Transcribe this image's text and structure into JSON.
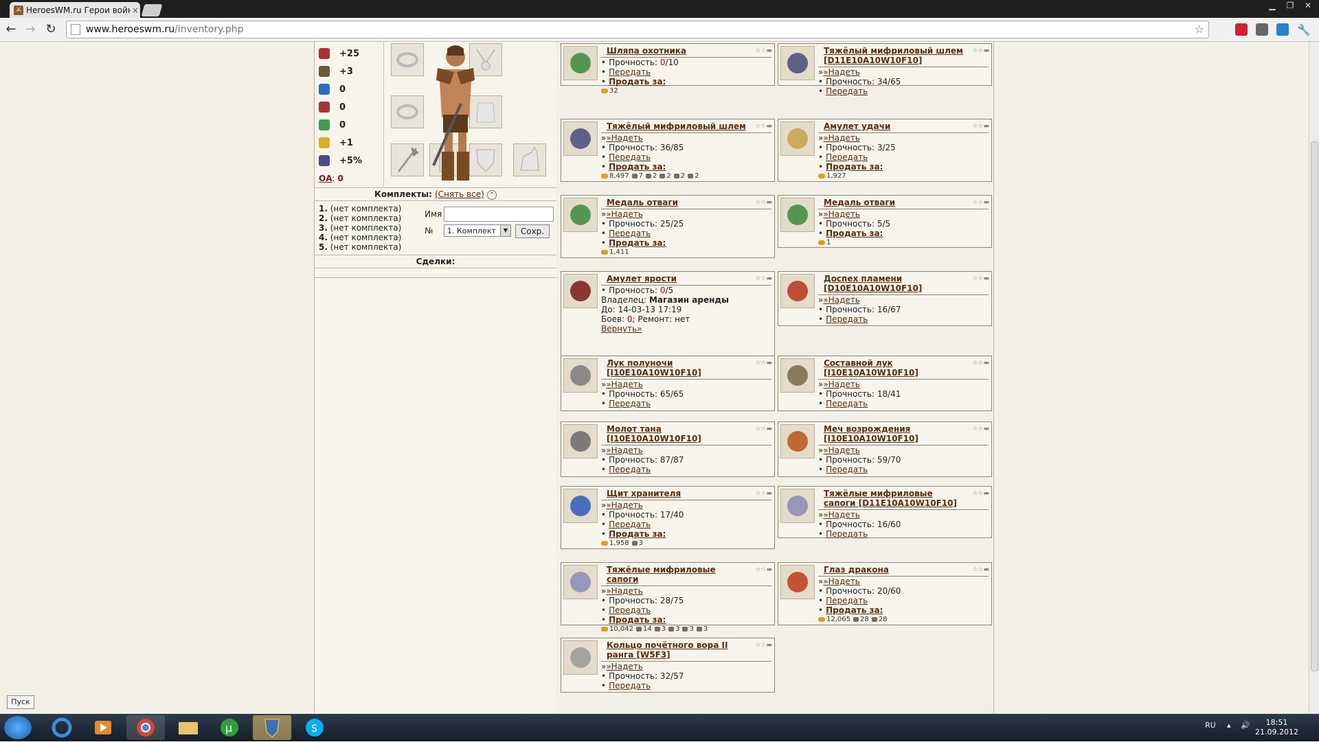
{
  "browser": {
    "tab_title": "HeroesWM.ru Герои войн",
    "url_host": "www.heroeswm.ru",
    "url_path": "/inventory.php"
  },
  "stats": [
    {
      "icon": "attack-icon",
      "value": "+25"
    },
    {
      "icon": "defense-icon",
      "value": "+3"
    },
    {
      "icon": "spellpower-icon",
      "value": "0"
    },
    {
      "icon": "knowledge-icon",
      "value": "0"
    },
    {
      "icon": "luck-icon",
      "value": "0"
    },
    {
      "icon": "morale-icon",
      "value": "+1"
    },
    {
      "icon": "initiative-icon",
      "value": "+5%"
    }
  ],
  "oa": {
    "label": "ОА",
    "value": "0"
  },
  "kits": {
    "header_label": "Комплекты:",
    "remove_all": "(Снять все)",
    "items": [
      {
        "num": "1.",
        "text": "(нет комплекта)"
      },
      {
        "num": "2.",
        "text": "(нет комплекта)"
      },
      {
        "num": "3.",
        "text": "(нет комплекта)"
      },
      {
        "num": "4.",
        "text": "(нет комплекта)"
      },
      {
        "num": "5.",
        "text": "(нет комплекта)"
      }
    ],
    "name_label": "Имя",
    "num_label": "№",
    "select_value": "1. Комплект",
    "save_label": "Сохр."
  },
  "deals": {
    "header": "Сделки:"
  },
  "items": [
    {
      "title": "Шляпа охотника",
      "lines": [
        {
          "t": "bullet",
          "parts": [
            [
              "Прочность: ",
              ""
            ],
            [
              "0",
              "red"
            ],
            [
              "/10",
              ""
            ]
          ]
        },
        {
          "t": "bullet",
          "parts": [
            [
              "Передать",
              "link"
            ]
          ]
        },
        {
          "t": "bullet",
          "parts": [
            [
              "Продать за:",
              "link bold"
            ]
          ]
        },
        {
          "t": "res",
          "parts": [
            [
              "32",
              "coin"
            ]
          ]
        }
      ]
    },
    {
      "title": "Тяжёлый мифриловый шлем [D11E10A10W10F10]",
      "lines": [
        {
          "t": "plain",
          "parts": [
            [
              "»",
              ""
            ],
            [
              "»Надеть",
              "link"
            ]
          ]
        },
        {
          "t": "bullet",
          "parts": [
            [
              "Прочность: 34/65",
              ""
            ]
          ]
        },
        {
          "t": "bullet",
          "parts": [
            [
              "Передать",
              "link"
            ]
          ]
        }
      ]
    },
    {
      "title": "Тяжёлый мифриловый шлем",
      "lines": [
        {
          "t": "plain",
          "parts": [
            [
              "»",
              ""
            ],
            [
              "»Надеть",
              "link"
            ]
          ]
        },
        {
          "t": "bullet",
          "parts": [
            [
              "Прочность: 36/85",
              ""
            ]
          ]
        },
        {
          "t": "bullet",
          "parts": [
            [
              "Передать",
              "link"
            ]
          ]
        },
        {
          "t": "bullet",
          "parts": [
            [
              "Продать за:",
              "link bold"
            ]
          ]
        },
        {
          "t": "res",
          "parts": [
            [
              "8,497",
              "coin"
            ],
            [
              "7",
              "ore"
            ],
            [
              "2",
              "ore"
            ],
            [
              "2",
              "ore"
            ],
            [
              "2",
              "ore"
            ],
            [
              "2",
              "ore"
            ]
          ]
        }
      ]
    },
    {
      "title": "Амулет удачи",
      "lines": [
        {
          "t": "plain",
          "parts": [
            [
              "»",
              ""
            ],
            [
              "»Надеть",
              "link"
            ]
          ]
        },
        {
          "t": "bullet",
          "parts": [
            [
              "Прочность: 3/25",
              ""
            ]
          ]
        },
        {
          "t": "bullet",
          "parts": [
            [
              "Передать",
              "link"
            ]
          ]
        },
        {
          "t": "bullet",
          "parts": [
            [
              "Продать за:",
              "link bold"
            ]
          ]
        },
        {
          "t": "res",
          "parts": [
            [
              "1,927",
              "coin"
            ]
          ]
        }
      ]
    },
    {
      "title": "Медаль отваги",
      "lines": [
        {
          "t": "plain",
          "parts": [
            [
              "»",
              ""
            ],
            [
              "»Надеть",
              "link"
            ]
          ]
        },
        {
          "t": "bullet",
          "parts": [
            [
              "Прочность: 25/25",
              ""
            ]
          ]
        },
        {
          "t": "bullet",
          "parts": [
            [
              "Передать",
              "link"
            ]
          ]
        },
        {
          "t": "bullet",
          "parts": [
            [
              "Продать за:",
              "link bold"
            ]
          ]
        },
        {
          "t": "res",
          "parts": [
            [
              "1,411",
              "coin"
            ]
          ]
        }
      ]
    },
    {
      "title": "Медаль отваги",
      "lines": [
        {
          "t": "plain",
          "parts": [
            [
              "»",
              ""
            ],
            [
              "»Надеть",
              "link"
            ]
          ]
        },
        {
          "t": "bullet",
          "parts": [
            [
              "Прочность: 5/5",
              ""
            ]
          ]
        },
        {
          "t": "bullet",
          "parts": [
            [
              "Продать за:",
              "link bold"
            ]
          ]
        },
        {
          "t": "res",
          "parts": [
            [
              "1",
              "coin"
            ]
          ]
        }
      ]
    },
    {
      "title": "Амулет ярости",
      "lines": [
        {
          "t": "plain",
          "parts": [
            [
              " ",
              ""
            ]
          ]
        },
        {
          "t": "bullet",
          "parts": [
            [
              "Прочность: ",
              ""
            ],
            [
              "0",
              "red"
            ],
            [
              "/5",
              ""
            ]
          ]
        },
        {
          "t": "plain",
          "parts": [
            [
              "Владелец: ",
              ""
            ],
            [
              "Магазин аренды",
              "bold"
            ]
          ]
        },
        {
          "t": "plain",
          "parts": [
            [
              "До: 14-03-13 17:19",
              ""
            ]
          ]
        },
        {
          "t": "plain",
          "parts": [
            [
              "Боев: ",
              ""
            ],
            [
              "0",
              "red"
            ],
            [
              ";   Ремонт: нет",
              ""
            ]
          ]
        },
        {
          "t": "plain",
          "parts": [
            [
              " Вернуть»",
              "link"
            ]
          ]
        }
      ]
    },
    {
      "title": "Доспех пламени [D10E10A10W10F10]",
      "lines": [
        {
          "t": "plain",
          "parts": [
            [
              "»",
              ""
            ],
            [
              "»Надеть",
              "link"
            ]
          ]
        },
        {
          "t": "bullet",
          "parts": [
            [
              "Прочность: 16/67",
              ""
            ]
          ]
        },
        {
          "t": "bullet",
          "parts": [
            [
              "Передать",
              "link"
            ]
          ]
        }
      ]
    },
    {
      "title": "Лук полуночи [I10E10A10W10F10]",
      "lines": [
        {
          "t": "plain",
          "parts": [
            [
              "»",
              ""
            ],
            [
              "»Надеть",
              "link"
            ]
          ]
        },
        {
          "t": "bullet",
          "parts": [
            [
              "Прочность: 65/65",
              ""
            ]
          ]
        },
        {
          "t": "bullet",
          "parts": [
            [
              "Передать",
              "link"
            ]
          ]
        }
      ]
    },
    {
      "title": "Составной лук [I10E10A10W10F10]",
      "lines": [
        {
          "t": "plain",
          "parts": [
            [
              "»",
              ""
            ],
            [
              "»Надеть",
              "link"
            ]
          ]
        },
        {
          "t": "bullet",
          "parts": [
            [
              "Прочность: 18/41",
              ""
            ]
          ]
        },
        {
          "t": "bullet",
          "parts": [
            [
              "Передать",
              "link"
            ]
          ]
        }
      ]
    },
    {
      "title": "Молот тана [I10E10A10W10F10]",
      "lines": [
        {
          "t": "plain",
          "parts": [
            [
              "»",
              ""
            ],
            [
              "»Надеть",
              "link"
            ]
          ]
        },
        {
          "t": "bullet",
          "parts": [
            [
              "Прочность: 87/87",
              ""
            ]
          ]
        },
        {
          "t": "bullet",
          "parts": [
            [
              "Передать",
              "link"
            ]
          ]
        }
      ]
    },
    {
      "title": "Меч возрождения [I10E10A10W10F10]",
      "lines": [
        {
          "t": "plain",
          "parts": [
            [
              "»",
              ""
            ],
            [
              "»Надеть",
              "link"
            ]
          ]
        },
        {
          "t": "bullet",
          "parts": [
            [
              "Прочность: 59/70",
              ""
            ]
          ]
        },
        {
          "t": "bullet",
          "parts": [
            [
              "Передать",
              "link"
            ]
          ]
        }
      ]
    },
    {
      "title": "Щит хранителя",
      "lines": [
        {
          "t": "plain",
          "parts": [
            [
              "»",
              ""
            ],
            [
              "»Надеть",
              "link"
            ]
          ]
        },
        {
          "t": "bullet",
          "parts": [
            [
              "Прочность: 17/40",
              ""
            ]
          ]
        },
        {
          "t": "bullet",
          "parts": [
            [
              "Передать",
              "link"
            ]
          ]
        },
        {
          "t": "bullet",
          "parts": [
            [
              "Продать за:",
              "link bold"
            ]
          ]
        },
        {
          "t": "res",
          "parts": [
            [
              "1,958",
              "coin"
            ],
            [
              "3",
              "ore"
            ]
          ]
        }
      ]
    },
    {
      "title": "Тяжёлые мифриловые сапоги [D11E10A10W10F10]",
      "lines": [
        {
          "t": "plain",
          "parts": [
            [
              "»",
              ""
            ],
            [
              "»Надеть",
              "link"
            ]
          ]
        },
        {
          "t": "bullet",
          "parts": [
            [
              "Прочность: 16/60",
              ""
            ]
          ]
        },
        {
          "t": "bullet",
          "parts": [
            [
              "Передать",
              "link"
            ]
          ]
        }
      ]
    },
    {
      "title": "Тяжёлые мифриловые сапоги",
      "lines": [
        {
          "t": "plain",
          "parts": [
            [
              "»",
              ""
            ],
            [
              "»Надеть",
              "link"
            ]
          ]
        },
        {
          "t": "bullet",
          "parts": [
            [
              "Прочность: 28/75",
              ""
            ]
          ]
        },
        {
          "t": "bullet",
          "parts": [
            [
              "Передать",
              "link"
            ]
          ]
        },
        {
          "t": "bullet",
          "parts": [
            [
              "Продать за:",
              "link bold"
            ]
          ]
        },
        {
          "t": "res",
          "parts": [
            [
              "10,042",
              "coin"
            ],
            [
              "14",
              "ore"
            ],
            [
              "3",
              "ore"
            ],
            [
              "3",
              "ore"
            ],
            [
              "3",
              "ore"
            ],
            [
              "3",
              "ore"
            ]
          ]
        }
      ]
    },
    {
      "title": "Глаз дракона",
      "lines": [
        {
          "t": "plain",
          "parts": [
            [
              "»",
              ""
            ],
            [
              "»Надеть",
              "link"
            ]
          ]
        },
        {
          "t": "bullet",
          "parts": [
            [
              "Прочность: 20/60",
              ""
            ]
          ]
        },
        {
          "t": "bullet",
          "parts": [
            [
              "Передать",
              "link"
            ]
          ]
        },
        {
          "t": "bullet",
          "parts": [
            [
              "Продать за:",
              "link bold"
            ]
          ]
        },
        {
          "t": "res",
          "parts": [
            [
              "12,065",
              "coin"
            ],
            [
              "28",
              "ore"
            ],
            [
              "28",
              "ore"
            ]
          ]
        }
      ]
    },
    {
      "title": "Кольцо почётного вора II ранга [W5F3]",
      "lines": [
        {
          "t": "plain",
          "parts": [
            [
              "»",
              ""
            ],
            [
              "»Надеть",
              "link"
            ]
          ]
        },
        {
          "t": "bullet",
          "parts": [
            [
              "Прочность: 32/57",
              ""
            ]
          ]
        },
        {
          "t": "bullet",
          "parts": [
            [
              "Передать",
              "link"
            ]
          ]
        }
      ]
    }
  ],
  "taskbar": {
    "start_label": "Пуск",
    "lang": "RU",
    "time": "18:51",
    "date": "21.09.2012"
  },
  "colors": {
    "accent_link": "#5a2d0c",
    "page_bg": "#f2efe6",
    "warning_red": "#cc0000"
  }
}
